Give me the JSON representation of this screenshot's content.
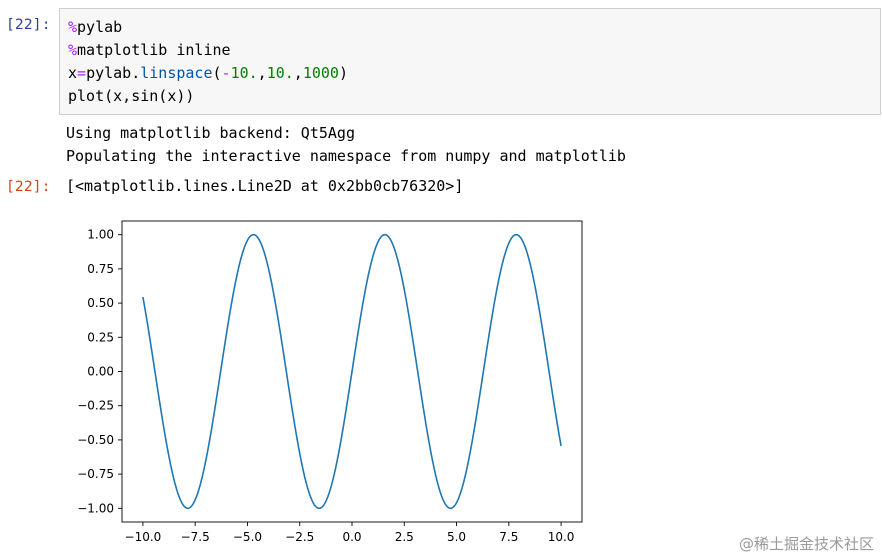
{
  "notebook": {
    "input_prompt": "[22]:",
    "output_prompt": "[22]:",
    "code": {
      "line1_magic": "%",
      "line1_text": "pylab",
      "line2_magic": "%",
      "line2_text": "matplotlib inline",
      "line3_var": "x",
      "line3_eq": "=",
      "line3_mod": "pylab.",
      "line3_fn": "linspace",
      "line3_paren_open": "(",
      "line3_minus": "-",
      "line3_arg1": "10.",
      "line3_comma1": ",",
      "line3_arg2": "10.",
      "line3_comma2": ",",
      "line3_arg3": "1000",
      "line3_paren_close": ")",
      "line4": "plot(x,sin(x))"
    },
    "stream_output": [
      "Using matplotlib backend: Qt5Agg",
      "Populating the interactive namespace from numpy and matplotlib"
    ],
    "repr_output": "[<matplotlib.lines.Line2D at 0x2bb0cb76320>]"
  },
  "chart_data": {
    "type": "line",
    "title": "",
    "xlabel": "",
    "ylabel": "",
    "function": "sin(x)",
    "x_range": [
      -10.0,
      10.0
    ],
    "num_points": 1000,
    "xlim": [
      -11.0,
      11.0
    ],
    "ylim": [
      -1.1,
      1.1
    ],
    "xticks": [
      -10.0,
      -7.5,
      -5.0,
      -2.5,
      0.0,
      2.5,
      5.0,
      7.5,
      10.0
    ],
    "xtick_labels": [
      "−10.0",
      "−7.5",
      "−5.0",
      "−2.5",
      "0.0",
      "2.5",
      "5.0",
      "7.5",
      "10.0"
    ],
    "yticks": [
      1.0,
      0.75,
      0.5,
      0.25,
      0.0,
      -0.25,
      -0.5,
      -0.75,
      -1.0
    ],
    "ytick_labels": [
      "1.00",
      "0.75",
      "0.50",
      "0.25",
      "0.00",
      "−0.25",
      "−0.50",
      "−0.75",
      "−1.00"
    ],
    "series": [
      {
        "color": "#1f77b4"
      }
    ],
    "grid": false
  },
  "watermark": "@稀土掘金技术社区"
}
